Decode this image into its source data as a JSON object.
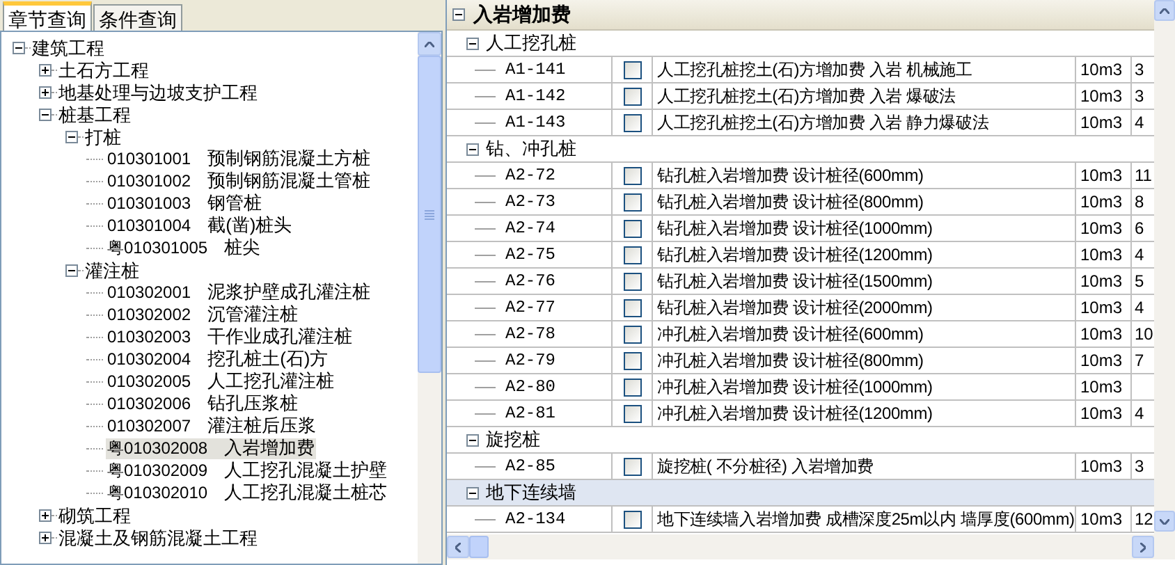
{
  "left_panel": {
    "tabs": [
      {
        "label": "章节查询",
        "selected": true
      },
      {
        "label": "条件查询",
        "selected": false
      }
    ],
    "tree": [
      {
        "label": "建筑工程",
        "expanded": true,
        "selected": false,
        "children": [
          {
            "label": "土石方工程",
            "expanded": false,
            "selected": false
          },
          {
            "label": "地基处理与边坡支护工程",
            "expanded": false,
            "selected": false
          },
          {
            "label": "桩基工程",
            "expanded": true,
            "selected": false,
            "children": [
              {
                "label": "打桩",
                "expanded": true,
                "selected": false,
                "children": [
                  {
                    "code": "010301001",
                    "name": "预制钢筋混凝土方桩",
                    "selected": false
                  },
                  {
                    "code": "010301002",
                    "name": "预制钢筋混凝土管桩",
                    "selected": false
                  },
                  {
                    "code": "010301003",
                    "name": "钢管桩",
                    "selected": false
                  },
                  {
                    "code": "010301004",
                    "name": "截(凿)桩头",
                    "selected": false
                  },
                  {
                    "code": "粤010301005",
                    "name": "桩尖",
                    "selected": false
                  }
                ]
              },
              {
                "label": "灌注桩",
                "expanded": true,
                "selected": false,
                "children": [
                  {
                    "code": "010302001",
                    "name": "泥浆护壁成孔灌注桩",
                    "selected": false
                  },
                  {
                    "code": "010302002",
                    "name": "沉管灌注桩",
                    "selected": false
                  },
                  {
                    "code": "010302003",
                    "name": "干作业成孔灌注桩",
                    "selected": false
                  },
                  {
                    "code": "010302004",
                    "name": "挖孔桩土(石)方",
                    "selected": false
                  },
                  {
                    "code": "010302005",
                    "name": "人工挖孔灌注桩",
                    "selected": false
                  },
                  {
                    "code": "010302006",
                    "name": "钻孔压浆桩",
                    "selected": false
                  },
                  {
                    "code": "010302007",
                    "name": "灌注桩后压浆",
                    "selected": false
                  },
                  {
                    "code": "粤010302008",
                    "name": "入岩增加费",
                    "selected": true
                  },
                  {
                    "code": "粤010302009",
                    "name": "人工挖孔混凝土护壁",
                    "selected": false
                  },
                  {
                    "code": "粤010302010",
                    "name": "人工挖孔混凝土桩芯",
                    "selected": false
                  }
                ]
              }
            ]
          },
          {
            "label": "砌筑工程",
            "expanded": false,
            "selected": false
          },
          {
            "label": "混凝土及钢筋混凝土工程",
            "expanded": false,
            "selected": false
          }
        ]
      }
    ]
  },
  "right_panel": {
    "title": "入岩增加费",
    "expanded": true,
    "groups": [
      {
        "title": "人工挖孔桩",
        "expanded": true,
        "selected": false,
        "rows": [
          {
            "code": "A1-141",
            "checked": false,
            "name": "人工挖孔桩挖土(石)方增加费 入岩 机械施工",
            "unit": "10m3",
            "column_5": "3"
          },
          {
            "code": "A1-142",
            "checked": false,
            "name": "人工挖孔桩挖土(石)方增加费 入岩 爆破法",
            "unit": "10m3",
            "column_5": "3"
          },
          {
            "code": "A1-143",
            "checked": false,
            "name": "人工挖孔桩挖土(石)方增加费 入岩 静力爆破法",
            "unit": "10m3",
            "column_5": "4"
          }
        ]
      },
      {
        "title": "钻、冲孔桩",
        "expanded": true,
        "selected": false,
        "rows": [
          {
            "code": "A2-72",
            "checked": false,
            "name": "钻孔桩入岩增加费 设计桩径(600mm)",
            "unit": "10m3",
            "column_5": "11"
          },
          {
            "code": "A2-73",
            "checked": false,
            "name": "钻孔桩入岩增加费 设计桩径(800mm)",
            "unit": "10m3",
            "column_5": "8"
          },
          {
            "code": "A2-74",
            "checked": false,
            "name": "钻孔桩入岩增加费 设计桩径(1000mm)",
            "unit": "10m3",
            "column_5": "6"
          },
          {
            "code": "A2-75",
            "checked": false,
            "name": "钻孔桩入岩增加费 设计桩径(1200mm)",
            "unit": "10m3",
            "column_5": "4"
          },
          {
            "code": "A2-76",
            "checked": false,
            "name": "钻孔桩入岩增加费 设计桩径(1500mm)",
            "unit": "10m3",
            "column_5": "5"
          },
          {
            "code": "A2-77",
            "checked": false,
            "name": "钻孔桩入岩增加费 设计桩径(2000mm)",
            "unit": "10m3",
            "column_5": "4"
          },
          {
            "code": "A2-78",
            "checked": false,
            "name": "冲孔桩入岩增加费 设计桩径(600mm)",
            "unit": "10m3",
            "column_5": "10"
          },
          {
            "code": "A2-79",
            "checked": false,
            "name": "冲孔桩入岩增加费 设计桩径(800mm)",
            "unit": "10m3",
            "column_5": "7"
          },
          {
            "code": "A2-80",
            "checked": false,
            "name": "冲孔桩入岩增加费 设计桩径(1000mm)",
            "unit": "10m3"
          },
          {
            "code": "A2-81",
            "checked": false,
            "name": "冲孔桩入岩增加费 设计桩径(1200mm)",
            "unit": "10m3",
            "column_5": "4"
          }
        ]
      },
      {
        "title": "旋挖桩",
        "expanded": true,
        "selected": false,
        "rows": [
          {
            "code": "A2-85",
            "checked": false,
            "name": "旋挖桩( 不分桩径) 入岩增加费",
            "unit": "10m3",
            "column_5": "3"
          }
        ]
      },
      {
        "title": "地下连续墙",
        "expanded": true,
        "selected": true,
        "rows": [
          {
            "code": "A2-134",
            "checked": false,
            "name": "地下连续墙入岩增加费 成槽深度25m以内 墙厚度(600mm)",
            "unit": "10m3",
            "column_5": "12"
          }
        ]
      }
    ]
  }
}
